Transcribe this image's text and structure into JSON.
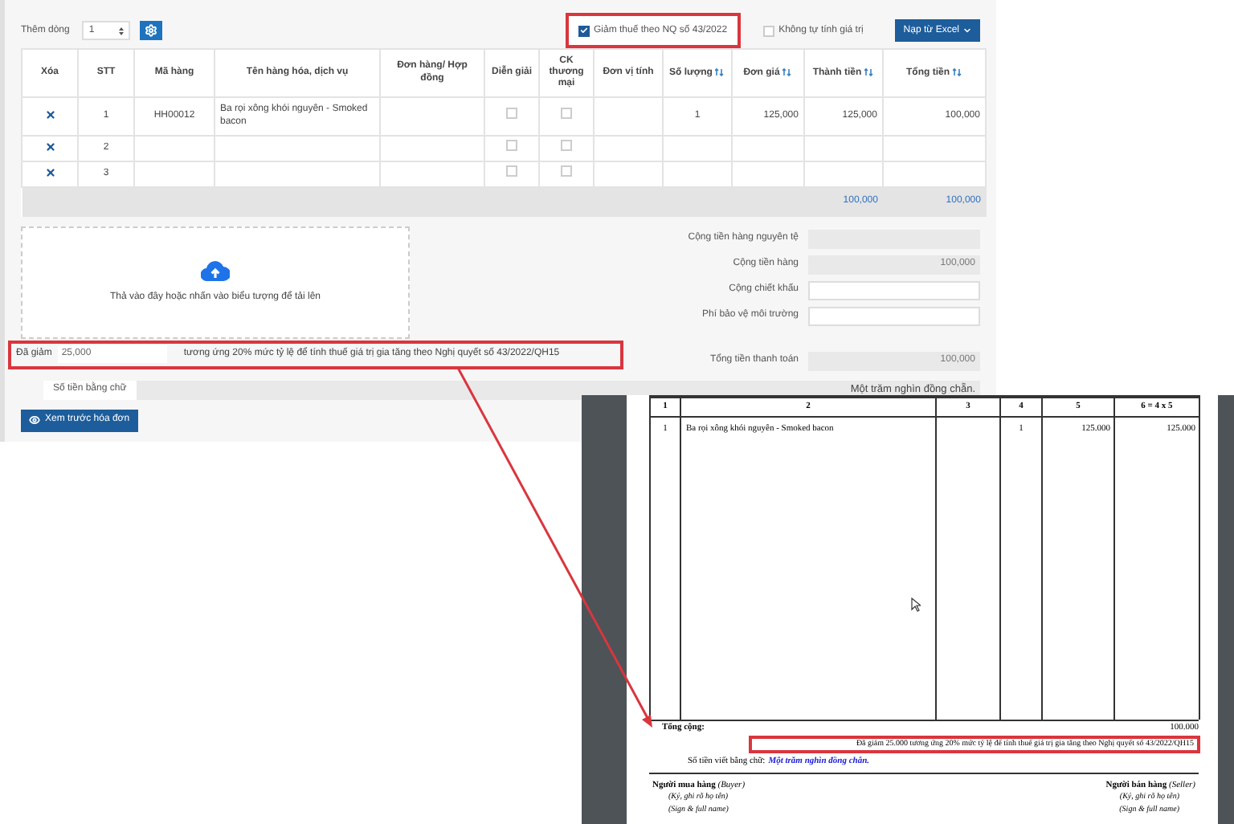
{
  "toolbar": {
    "add_rows_label": "Thêm dòng",
    "add_rows_value": "1",
    "options": [
      {
        "label": "Giảm thuế theo NQ số 43/2022",
        "checked": true,
        "highlighted": true
      },
      {
        "label": "Không tự tính giá trị",
        "checked": false,
        "highlighted": false
      }
    ],
    "import_button": "Nạp từ Excel"
  },
  "table": {
    "columns": [
      {
        "label": "Xóa"
      },
      {
        "label": "STT"
      },
      {
        "label": "Mã hàng"
      },
      {
        "label": "Tên hàng hóa, dịch vụ"
      },
      {
        "label": "Đơn hàng/ Hợp đồng"
      },
      {
        "label": "Diễn giải"
      },
      {
        "label": "CK thương mại"
      },
      {
        "label": "Đơn vị tính"
      },
      {
        "label": "Số lượng",
        "sortable": true
      },
      {
        "label": "Đơn giá",
        "sortable": true
      },
      {
        "label": "Thành tiền",
        "sortable": true
      },
      {
        "label": "Tổng tiền",
        "sortable": true
      }
    ],
    "rows": [
      {
        "index": "1",
        "code": "HH00012",
        "name": "Ba rọi xông khói nguyên - Smoked bacon",
        "description_checked": false,
        "trade_discount_checked": false,
        "quantity": "1",
        "unit_price": "125,000",
        "amount": "125,000",
        "total": "100,000"
      },
      {
        "index": "2",
        "description_checked": false,
        "trade_discount_checked": false
      },
      {
        "index": "3",
        "description_checked": false,
        "trade_discount_checked": false
      }
    ],
    "footer": {
      "amount": "100,000",
      "total": "100,000"
    }
  },
  "upload": {
    "text": "Thả vào đây hoặc nhấn vào biểu tượng để tải lên"
  },
  "summary": [
    {
      "label": "Cộng tiền hàng nguyên tệ",
      "kind": "readonly"
    },
    {
      "label": "Cộng tiền hàng",
      "value": "100,000",
      "kind": "readonly"
    },
    {
      "label": "Cộng chiết khấu",
      "kind": "input"
    },
    {
      "label": "Phí bảo vệ môi trường",
      "kind": "input"
    },
    {
      "label": "Tổng tiền thanh toán",
      "value": "100,000",
      "kind": "readonly"
    }
  ],
  "discount_note": {
    "label": "Đã giảm",
    "value": "25,000",
    "text": "tương ứng 20% mức tỷ lệ để tính thuế giá trị gia tăng theo Nghị quyết số 43/2022/QH15",
    "highlighted": true
  },
  "amount_in_words": {
    "label": "Số tiền bằng chữ",
    "value": "Một trăm nghìn đồng chẵn."
  },
  "preview_button": "Xem trước hóa đơn",
  "invoice_preview": {
    "column_numbers": [
      "1",
      "2",
      "3",
      "4",
      "5",
      "6 = 4 x 5"
    ],
    "rows": [
      {
        "index": "1",
        "name": "Ba rọi xông khói nguyên - Smoked bacon",
        "quantity": "1",
        "unit_price": "125.000",
        "amount": "125.000"
      }
    ],
    "total_label": "Tổng cộng:",
    "total_value": "100.000",
    "discount_note": {
      "text": "Đã giảm 25.000 tương ứng 20% mức tỷ lệ để tính thuế giá trị gia tăng theo Nghị quyết số 43/2022/QH15",
      "highlighted": true
    },
    "words_label": "Số tiền viết bằng chữ:",
    "words_value": "Một trăm nghìn đồng chẵn.",
    "signatures": [
      {
        "title": "**Người mua hàng** *(Buyer)*",
        "lines": [
          "(Ký, ghi rõ họ tên)",
          "(Sign & full name)"
        ]
      },
      {
        "title": "**Người bán hàng** *(Seller)*",
        "lines": [
          "(Ký, ghi rõ họ tên)",
          "(Sign & full name)"
        ]
      }
    ]
  }
}
